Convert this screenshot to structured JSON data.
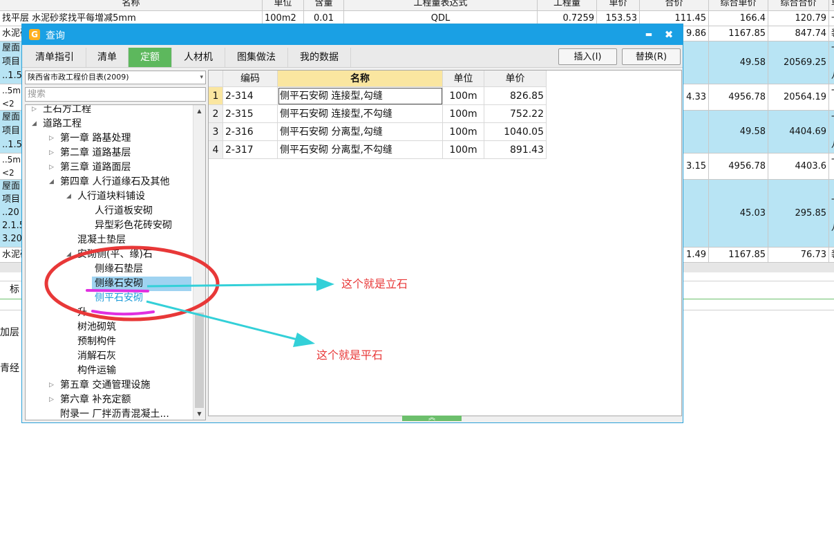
{
  "background_sheet": {
    "headers": [
      "名称",
      "单位",
      "含量",
      "工程量表达式",
      "工程量",
      "单价",
      "合价",
      "综合单价",
      "综合合价",
      "单"
    ],
    "row1": {
      "name": "找平层 水泥砂浆找平每增减5mm",
      "unit": "100m2",
      "qty_ratio": "0.01",
      "expr": "QDL",
      "qty": "0.7259",
      "price": "153.53",
      "total": "111.45",
      "comp_price": "166.4",
      "comp_total": "120.79",
      "last": "一"
    },
    "row2": {
      "name": "水泥砂",
      "total": "9.86",
      "comp_price": "1167.85",
      "comp_total": "847.74",
      "last": "装"
    },
    "row3": {
      "lines": [
        "屋面",
        "项目",
        "..1.5"
      ],
      "comp_price": "49.58",
      "comp_total": "20569.25",
      "last": [
        "一",
        "（",
        "八"
      ]
    },
    "row4": {
      "lines": [
        "..5mm",
        "<2"
      ],
      "total": "4.33",
      "comp_price": "4956.78",
      "comp_total": "20564.19",
      "last": [
        "一",
        "（"
      ]
    },
    "row5": {
      "lines": [
        "屋面",
        "项目",
        "..1.5"
      ],
      "comp_price": "49.58",
      "comp_total": "4404.69",
      "last": [
        "一",
        "（",
        "八"
      ]
    },
    "row6": {
      "lines": [
        "..5mm",
        "<2"
      ],
      "total": "3.15",
      "comp_price": "4956.78",
      "comp_total": "4403.6",
      "last": [
        "一",
        "（"
      ]
    },
    "row7": {
      "lines": [
        "屋面",
        "项目",
        "..20",
        "2.1.5",
        "3.20"
      ],
      "comp_price": "45.03",
      "comp_total": "295.85",
      "last": [
        "一",
        "（",
        "八"
      ]
    },
    "row8": {
      "name": "水泥砂",
      "total": "1.49",
      "comp_price": "1167.85",
      "comp_total": "76.73",
      "last": "装"
    },
    "bottom_tab": "标",
    "side_texts": [
      "加层",
      "青经"
    ]
  },
  "dialog": {
    "title": "查询",
    "logo": "G",
    "min_icon": "▬",
    "close_icon": "✖",
    "tabs": [
      "清单指引",
      "清单",
      "定额",
      "人材机",
      "图集做法",
      "我的数据"
    ],
    "active_tab": "定额",
    "insert_label": "插入(I)",
    "replace_label": "替换(R)",
    "library": "陕西省市政工程价目表(2009)",
    "search_placeholder": "搜索",
    "tree": [
      {
        "label": "土石方工程",
        "toggle": "▷"
      },
      {
        "label": "道路工程",
        "toggle": "◢"
      },
      {
        "label": "第一章 路基处理",
        "toggle": "▷"
      },
      {
        "label": "第二章 道路基层",
        "toggle": "▷"
      },
      {
        "label": "第三章 道路面层",
        "toggle": "▷"
      },
      {
        "label": "第四章 人行道缘石及其他",
        "toggle": "◢"
      },
      {
        "label": "人行道块料铺设",
        "toggle": "◢"
      },
      {
        "label": "人行道板安砌",
        "toggle": ""
      },
      {
        "label": "异型彩色花砖安砌",
        "toggle": ""
      },
      {
        "label": "混凝土垫层",
        "toggle": ""
      },
      {
        "label": "安砌侧(平、缘)石",
        "toggle": "◢"
      },
      {
        "label": "侧缘石垫层",
        "toggle": ""
      },
      {
        "label": "侧缘石安砌",
        "toggle": ""
      },
      {
        "label": "侧平石安砌",
        "toggle": ""
      },
      {
        "label": "升",
        "toggle": ""
      },
      {
        "label": "树池砌筑",
        "toggle": ""
      },
      {
        "label": "预制构件",
        "toggle": ""
      },
      {
        "label": "消解石灰",
        "toggle": ""
      },
      {
        "label": "构件运输",
        "toggle": ""
      },
      {
        "label": "第五章 交通管理设施",
        "toggle": "▷"
      },
      {
        "label": "第六章 补充定额",
        "toggle": "▷"
      },
      {
        "label": "附录一 厂拌沥青混凝土...",
        "toggle": ""
      }
    ],
    "grid": {
      "headers": [
        "编码",
        "名称",
        "单位",
        "单价"
      ],
      "rows": [
        {
          "no": "1",
          "code": "2-314",
          "name": "侧平石安砌 连接型,勾缝",
          "unit": "100m",
          "price": "826.85"
        },
        {
          "no": "2",
          "code": "2-315",
          "name": "侧平石安砌 连接型,不勾缝",
          "unit": "100m",
          "price": "752.22"
        },
        {
          "no": "3",
          "code": "2-316",
          "name": "侧平石安砌 分离型,勾缝",
          "unit": "100m",
          "price": "1040.05"
        },
        {
          "no": "4",
          "code": "2-317",
          "name": "侧平石安砌 分离型,不勾缝",
          "unit": "100m",
          "price": "891.43"
        }
      ]
    },
    "splitter_icon": "︽"
  },
  "annotations": {
    "label_upright": "这个就是立石",
    "label_flat": "这个就是平石",
    "colors": {
      "circle": "#e83838",
      "arrow": "#33d0d8",
      "underline": "#e030e0",
      "text": "#e83838"
    }
  },
  "colors": {
    "title_bar": "#1aa0e4",
    "active_tab": "#5db85d",
    "selection": "#9fd3f1",
    "cyan_rows": "#b8e4f4",
    "header_highlight": "#fae6a0"
  }
}
